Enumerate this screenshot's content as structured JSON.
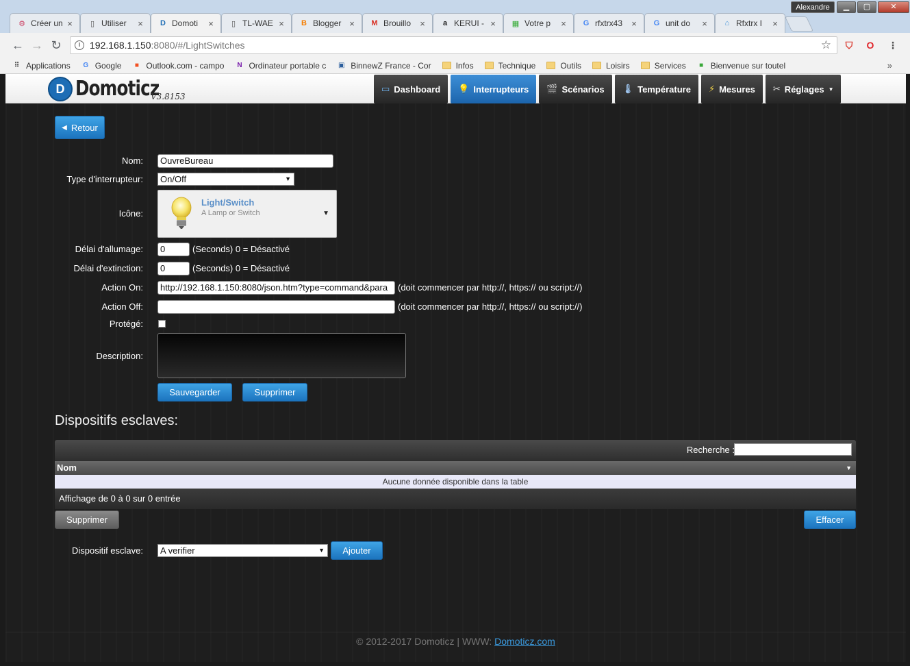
{
  "browser": {
    "user": "Alexandre",
    "window_buttons": {
      "minimize": "▁",
      "maximize": "▢",
      "close": "✕"
    },
    "tabs": [
      {
        "label": "Créer un",
        "icon": "⚙",
        "icon_color": "#c46"
      },
      {
        "label": "Utiliser",
        "icon": "▯",
        "icon_color": "#555"
      },
      {
        "label": "Domoti",
        "icon": "D",
        "icon_color": "#1d6db5"
      },
      {
        "label": "TL-WAE",
        "icon": "▯",
        "icon_color": "#555"
      },
      {
        "label": "Blogger",
        "icon": "B",
        "icon_color": "#f57d00"
      },
      {
        "label": "Brouillo",
        "icon": "M",
        "icon_color": "#d93025"
      },
      {
        "label": "KERUI -",
        "icon": "a",
        "icon_color": "#222"
      },
      {
        "label": "Votre p",
        "icon": "▦",
        "icon_color": "#3a3"
      },
      {
        "label": "rfxtrx43",
        "icon": "G",
        "icon_color": "#4285f4"
      },
      {
        "label": "unit do",
        "icon": "G",
        "icon_color": "#4285f4"
      },
      {
        "label": "Rfxtrx I",
        "icon": "⌂",
        "icon_color": "#3b8fd8"
      }
    ],
    "tab_close": "×",
    "address": {
      "host": "192.168.1.150",
      "path": ":8080/#/LightSwitches"
    },
    "bookmarks": [
      {
        "label": "Applications",
        "type": "apps"
      },
      {
        "label": "Google",
        "type": "google"
      },
      {
        "label": "Outlook.com - campo",
        "type": "ms"
      },
      {
        "label": "Ordinateur portable c",
        "type": "onenote"
      },
      {
        "label": "BinnewZ France - Cor",
        "type": "binnewz"
      },
      {
        "label": "Infos",
        "type": "folder"
      },
      {
        "label": "Technique",
        "type": "folder"
      },
      {
        "label": "Outils",
        "type": "folder"
      },
      {
        "label": "Loisirs",
        "type": "folder"
      },
      {
        "label": "Services",
        "type": "folder"
      },
      {
        "label": "Bienvenue sur toutel",
        "type": "green"
      }
    ],
    "bookmarks_more": "»"
  },
  "app": {
    "logo_name": "Domoticz",
    "logo_version": "V3.8153",
    "menu": [
      {
        "label": "Dashboard",
        "icon": "▭",
        "active": false
      },
      {
        "label": "Interrupteurs",
        "icon": "💡",
        "active": true
      },
      {
        "label": "Scénarios",
        "icon": "🎬",
        "active": false
      },
      {
        "label": "Température",
        "icon": "🌡",
        "active": false
      },
      {
        "label": "Mesures",
        "icon": "⚡",
        "active": false
      },
      {
        "label": "Réglages",
        "icon": "✂",
        "active": false,
        "dropdown": true
      }
    ]
  },
  "form": {
    "back_label": "Retour",
    "name_label": "Nom:",
    "name_value": "OuvreBureau",
    "type_label": "Type d'interrupteur:",
    "type_value": "On/Off",
    "icon_label": "Icône:",
    "icon_title": "Light/Switch",
    "icon_desc": "A Lamp or Switch",
    "on_delay_label": "Délai d'allumage:",
    "on_delay_value": "0",
    "off_delay_label": "Délai d'extinction:",
    "off_delay_value": "0",
    "delay_note": "(Seconds) 0 = Désactivé",
    "action_on_label": "Action On:",
    "action_on_value": "http://192.168.1.150:8080/json.htm?type=command&para",
    "action_off_label": "Action Off:",
    "action_off_value": "",
    "action_note": "(doit commencer par http://, https:// ou script://)",
    "protected_label": "Protégé:",
    "description_label": "Description:",
    "save_label": "Sauvegarder",
    "delete_label": "Supprimer"
  },
  "slaves": {
    "title": "Dispositifs esclaves:",
    "search_label": "Recherche :",
    "column_name": "Nom",
    "empty_text": "Aucune donnée disponible dans la table",
    "info_text": "Affichage de 0 à 0 sur 0 entrée",
    "delete_label": "Supprimer",
    "clear_label": "Effacer",
    "device_label": "Dispositif esclave:",
    "device_value": "A verifier",
    "add_label": "Ajouter"
  },
  "footer": {
    "text": "© 2012-2017 Domoticz | WWW: ",
    "link": "Domoticz.com"
  }
}
